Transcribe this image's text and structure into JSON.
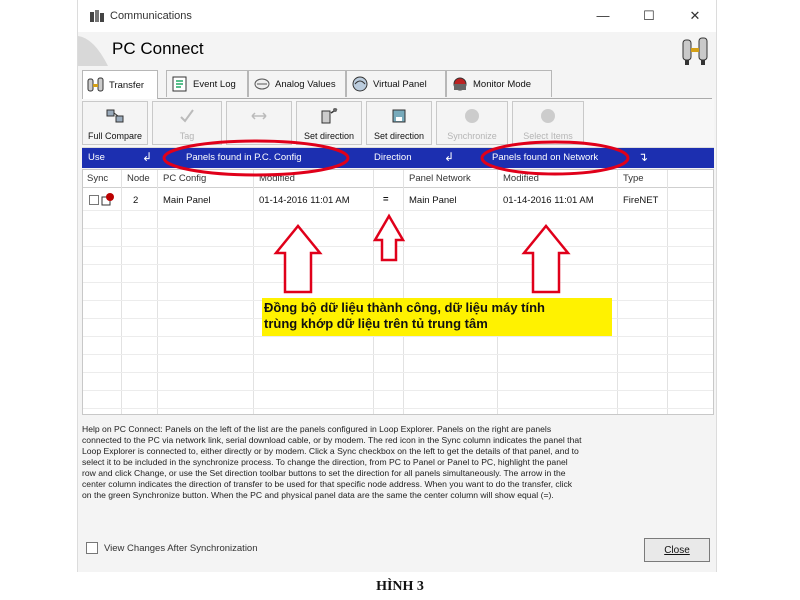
{
  "window": {
    "title": "Communications",
    "minimize_glyph": "—",
    "maximize_glyph": "☐",
    "close_glyph": "✕"
  },
  "header": {
    "title": "PC Connect"
  },
  "tabs": [
    {
      "label": "Transfer",
      "icon": "transfer-icon",
      "active": true
    },
    {
      "label": "Event Log",
      "icon": "event-log-icon"
    },
    {
      "label": "Analog Values",
      "icon": "analog-values-icon"
    },
    {
      "label": "Virtual Panel",
      "icon": "virtual-panel-icon"
    },
    {
      "label": "Monitor Mode",
      "icon": "monitor-mode-icon"
    }
  ],
  "toolbar": [
    {
      "label": "Full Compare",
      "icon": "compare-icon",
      "enabled": true
    },
    {
      "label": "Tag",
      "icon": "check-icon",
      "enabled": false
    },
    {
      "label": "",
      "icon": "arrows-icon",
      "enabled": false
    },
    {
      "label": "Set direction",
      "icon": "set-direction-pc-icon",
      "enabled": true
    },
    {
      "label": "Set direction",
      "icon": "set-direction-panel-icon",
      "enabled": true
    },
    {
      "label": "Synchronize",
      "icon": "synchronize-icon",
      "enabled": false
    },
    {
      "label": "Select Items",
      "icon": "select-items-icon",
      "enabled": false
    }
  ],
  "bluebar": {
    "use": "Use",
    "left_arrow": "↲",
    "pc_config_label": "Panels found in P.C. Config",
    "direction": "Direction",
    "mid_arrow": "↲",
    "network_label": "Panels found on Network",
    "right_arrow": "↴"
  },
  "grid": {
    "columns": [
      "Sync",
      "Node",
      "PC Config",
      "Modified",
      "",
      "Panel Network",
      "Modified",
      "Type"
    ],
    "rows": [
      {
        "sync_checked": false,
        "node": "2",
        "pc_config": "Main Panel",
        "modified_pc": "01-14-2016 11:01 AM",
        "direction": "=",
        "panel_network": "Main Panel",
        "modified_net": "01-14-2016 11:01 AM",
        "type": "FireNET"
      }
    ]
  },
  "annotation": {
    "line1": "Đồng bộ dữ liệu thành công, dữ liệu máy tính",
    "line2": "trùng khớp dữ liệu trên tủ trung tâm",
    "highlight_color": "#fff200",
    "oval_color": "#e0001a",
    "arrow_color": "#e0001a"
  },
  "help": {
    "lines": [
      "Help on PC Connect: Panels on the left of the list are the panels configured in Loop Explorer.  Panels on the right are panels",
      "connected to the PC via network link, serial download cable, or by modem.  The red icon in the Sync column indicates the panel that",
      "Loop Explorer is connected to, either directly or by modem.  Click a Sync checkbox on the left to get the details of that panel, and to",
      "select it to be included in the synchronize process.  To change the direction, from PC to Panel or Panel to PC, highlight the panel",
      "row and click Change, or use the Set direction toolbar buttons to set the direction for all panels simultaneously.  The arrow in the",
      "center column indicates the direction of transfer to be used for that specific node address.  When you want to do the transfer, click",
      "on the green Synchronize button.  When the PC and physical panel data are the same the center column will show equal (=)."
    ]
  },
  "footer": {
    "checkbox_label": "View Changes After Synchronization",
    "checkbox_checked": false,
    "close_label": "Close"
  },
  "caption": "HÌNH 3"
}
